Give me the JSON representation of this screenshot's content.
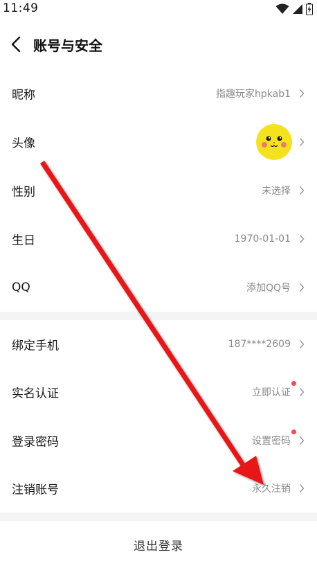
{
  "status_bar": {
    "time": "11:49"
  },
  "header": {
    "title": "账号与安全"
  },
  "profile": {
    "items": [
      {
        "label": "昵称",
        "value": "指趣玩家hpkab1"
      },
      {
        "label": "头像",
        "value": ""
      },
      {
        "label": "性别",
        "value": "未选择"
      },
      {
        "label": "生日",
        "value": "1970-01-01"
      },
      {
        "label": "QQ",
        "value": "添加QQ号"
      }
    ]
  },
  "security": {
    "items": [
      {
        "label": "绑定手机",
        "value": "187****2609",
        "dot": false
      },
      {
        "label": "实名认证",
        "value": "立即认证",
        "dot": true
      },
      {
        "label": "登录密码",
        "value": "设置密码",
        "dot": true
      },
      {
        "label": "注销账号",
        "value": "永久注销",
        "dot": false
      }
    ]
  },
  "logout": {
    "label": "退出登录"
  },
  "colors": {
    "accent_dot": "#f04a5b",
    "annotation_arrow": "#e81818",
    "avatar_yellow": "#f6e21c"
  }
}
